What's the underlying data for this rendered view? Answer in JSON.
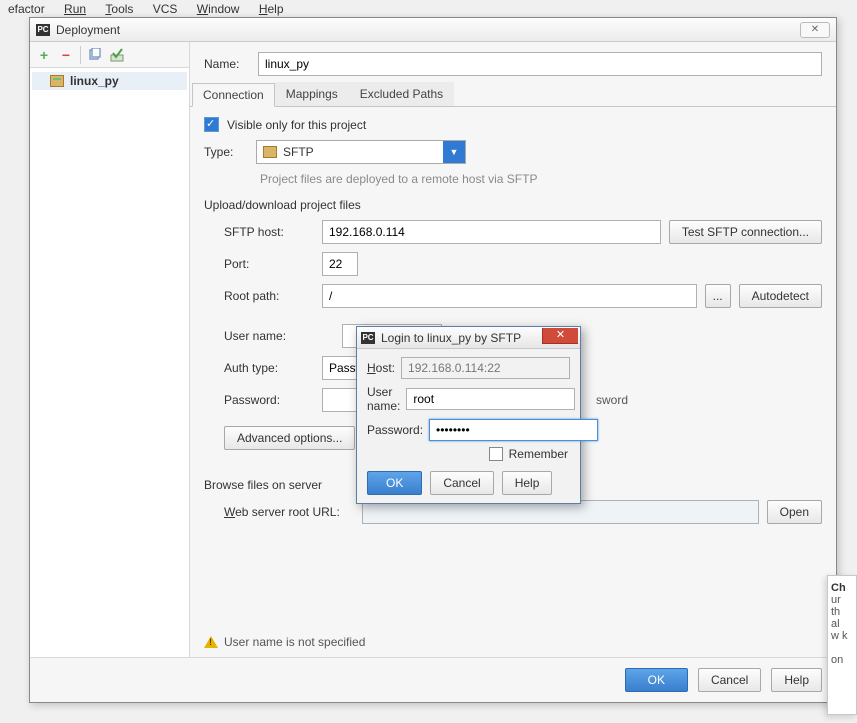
{
  "menubar": [
    "efactor",
    "Run",
    "Tools",
    "VCS",
    "Window",
    "Help"
  ],
  "menubar_accel_index": [
    -1,
    0,
    0,
    -1,
    0,
    0
  ],
  "dialog": {
    "title": "Deployment"
  },
  "toolbar": {
    "add": {
      "glyph": "+",
      "color": "#4faf4f"
    },
    "remove": {
      "glyph": "−",
      "color": "#d24b3a"
    },
    "copy": {
      "glyph": "",
      "color": "#5a8bc4"
    },
    "default": {
      "glyph": "✔",
      "color": "#5aa45a"
    }
  },
  "tree": {
    "items": [
      {
        "label": "linux_py"
      }
    ]
  },
  "name": {
    "label": "Name:",
    "value": "linux_py"
  },
  "tabs": [
    "Connection",
    "Mappings",
    "Excluded Paths"
  ],
  "active_tab": 0,
  "visible_only": {
    "label": "Visible only for this project",
    "checked": true
  },
  "type": {
    "label": "Type:",
    "value": "SFTP",
    "hint": "Project files are deployed to a remote host via SFTP"
  },
  "upload_section": "Upload/download project files",
  "fields": {
    "sftp_host": {
      "label": "SFTP host:",
      "value": "192.168.0.114"
    },
    "test_btn": "Test SFTP connection...",
    "port": {
      "label": "Port:",
      "value": "22"
    },
    "root_path": {
      "label": "Root path:",
      "value": "/",
      "browse": "...",
      "autodetect": "Autodetect"
    },
    "user_name": {
      "label": "User name:",
      "value": ""
    },
    "auth_type": {
      "label": "Auth type:",
      "value": "Passwo"
    },
    "password": {
      "label": "Password:",
      "value": "",
      "save_hint": "sword"
    },
    "advanced": "Advanced options..."
  },
  "browse_section": "Browse files on server",
  "web_root": {
    "label": "Web server root URL:",
    "value": "",
    "open": "Open"
  },
  "warning": "User name is not specified",
  "footer": {
    "ok": "OK",
    "cancel": "Cancel",
    "help": "Help"
  },
  "modal": {
    "title": "Login to linux_py by SFTP",
    "host": {
      "label": "Host:",
      "value": "192.168.0.114:22"
    },
    "user": {
      "label": "User name:",
      "value": "root"
    },
    "password": {
      "label": "Password:",
      "value": "••••••••"
    },
    "remember": "Remember",
    "ok": "OK",
    "cancel": "Cancel",
    "help": "Help"
  },
  "bgpanel": {
    "head": "Ch",
    "lines": [
      "ur",
      "th",
      "al",
      "w k",
      "",
      "on"
    ]
  }
}
